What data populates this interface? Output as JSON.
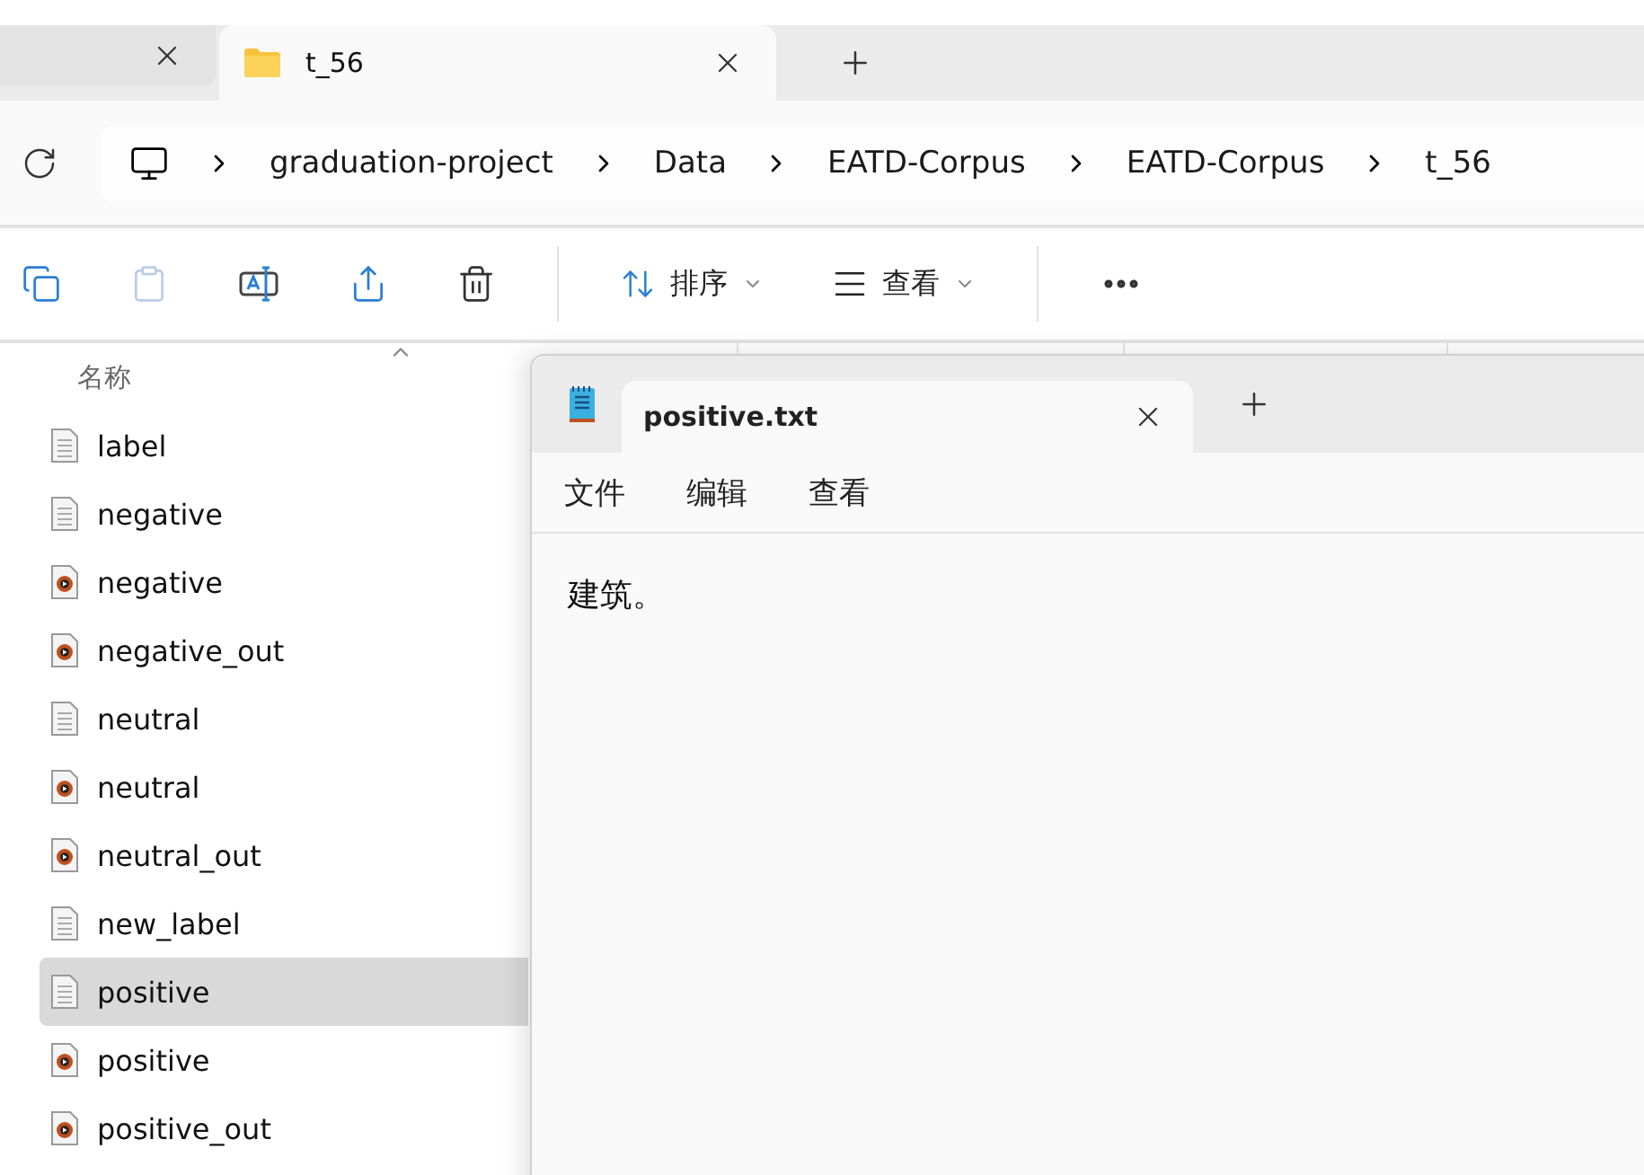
{
  "explorer": {
    "tabs": [
      {
        "selected": false
      },
      {
        "label": "t_56",
        "selected": true
      }
    ],
    "breadcrumb": [
      "graduation-project",
      "Data",
      "EATD-Corpus",
      "EATD-Corpus",
      "t_56"
    ],
    "toolbar": {
      "sort_label": "排序",
      "view_label": "查看"
    },
    "column_header": "名称",
    "files": [
      {
        "name": "label",
        "kind": "text",
        "selected": false
      },
      {
        "name": "negative",
        "kind": "text",
        "selected": false
      },
      {
        "name": "negative",
        "kind": "audio",
        "selected": false
      },
      {
        "name": "negative_out",
        "kind": "audio",
        "selected": false
      },
      {
        "name": "neutral",
        "kind": "text",
        "selected": false
      },
      {
        "name": "neutral",
        "kind": "audio",
        "selected": false
      },
      {
        "name": "neutral_out",
        "kind": "audio",
        "selected": false
      },
      {
        "name": "new_label",
        "kind": "text",
        "selected": false
      },
      {
        "name": "positive",
        "kind": "text",
        "selected": true
      },
      {
        "name": "positive",
        "kind": "audio",
        "selected": false
      },
      {
        "name": "positive_out",
        "kind": "audio",
        "selected": false
      }
    ]
  },
  "notepad": {
    "tab": {
      "label": "positive.txt",
      "selected": true
    },
    "menu": [
      "文件",
      "编辑",
      "查看"
    ],
    "content": "建筑。"
  }
}
